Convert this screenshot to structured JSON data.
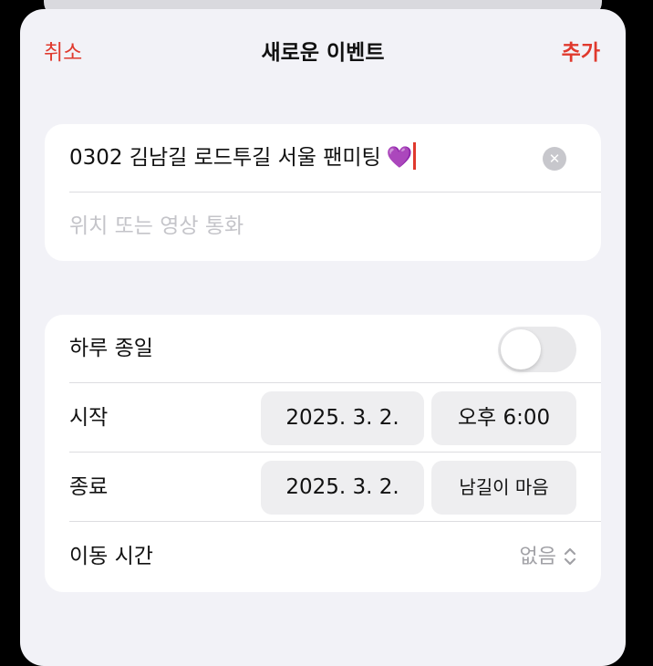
{
  "nav": {
    "cancel": "취소",
    "title": "새로운 이벤트",
    "add": "추가"
  },
  "event": {
    "title": "0302 김남길 로드투길 서울 팬미팅",
    "title_emoji": "💜",
    "location_placeholder": "위치 또는 영상 통화"
  },
  "details": {
    "all_day_label": "하루 종일",
    "all_day_on": false,
    "start_label": "시작",
    "start_date": "2025. 3. 2.",
    "start_time": "오후 6:00",
    "end_label": "종료",
    "end_date": "2025. 3. 2.",
    "end_time": "남길이 마음",
    "travel_label": "이동 시간",
    "travel_value": "없음"
  },
  "colors": {
    "accent": "#e0392d",
    "background": "#f2f2f7",
    "heart": "#a64ee8"
  },
  "icons": {
    "clear": "clear-x-circle-icon",
    "travel_picker": "up-down-chevron-icon"
  }
}
